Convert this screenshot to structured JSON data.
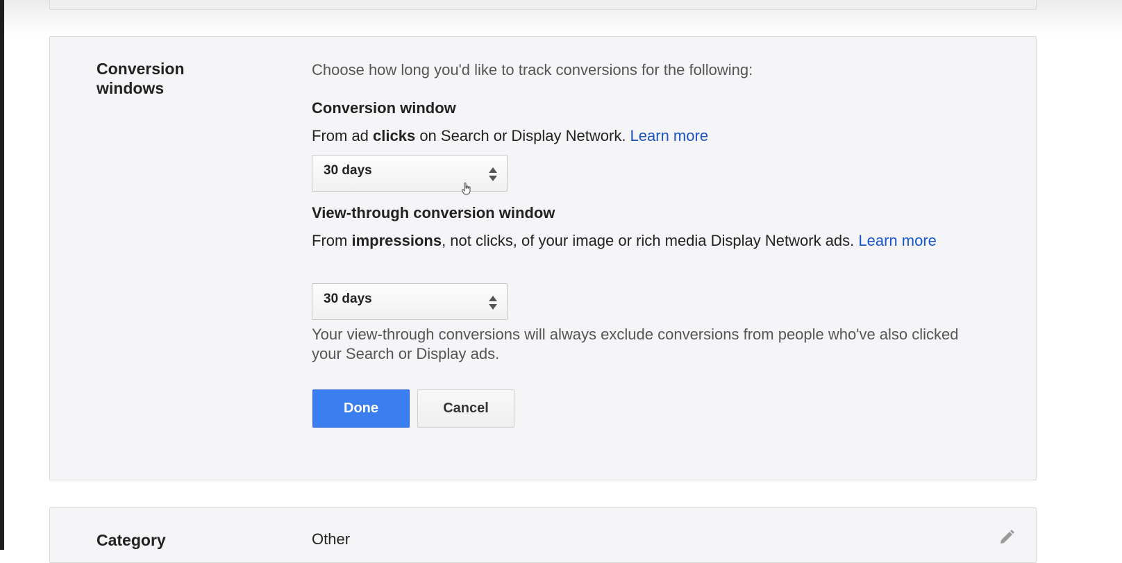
{
  "conversion_windows": {
    "section_title": "Conversion windows",
    "intro": "Choose how long you'd like to track conversions for the following:",
    "conversion_window": {
      "heading": "Conversion window",
      "desc_prefix": "From ad ",
      "desc_bold": "clicks",
      "desc_suffix": " on Search or Display Network. ",
      "learn_more": "Learn more",
      "selected": "30 days"
    },
    "view_through": {
      "heading": "View-through conversion window",
      "desc_prefix": "From ",
      "desc_bold": "impressions",
      "desc_suffix": ", not clicks, of your image or rich media Display Network ads. ",
      "learn_more": "Learn more",
      "selected": "30 days",
      "note": "Your view-through conversions will always exclude conversions from people who've also clicked your Search or Display ads."
    },
    "buttons": {
      "done": "Done",
      "cancel": "Cancel"
    }
  },
  "category": {
    "section_title": "Category",
    "value": "Other"
  },
  "icons": {
    "select_arrows": "sort-arrows-icon",
    "edit": "pencil-icon",
    "cursor": "hand-pointer-icon"
  },
  "colors": {
    "primary_button": "#3b7ef0",
    "link": "#1a55c8",
    "panel_background": "#f5f4f6"
  }
}
